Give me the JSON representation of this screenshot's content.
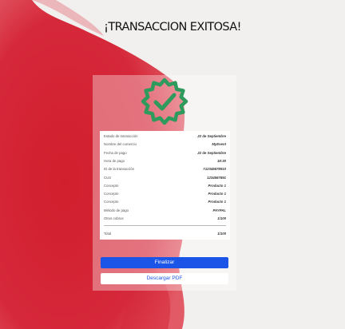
{
  "title": "¡TRANSACCION EXITOSA!",
  "colors": {
    "accent": "#1a55e8",
    "success": "#2e9a5b",
    "background_red": "#d32230"
  },
  "icons": {
    "success_badge": "check-badge-icon"
  },
  "receipt": {
    "rows": [
      {
        "label": "Estado de transacción",
        "value": "22 de Septiembre"
      },
      {
        "label": "Nombre del comercio",
        "value": "MyEvent"
      },
      {
        "label": "Fecha de pago",
        "value": "22 de Septiembre"
      },
      {
        "label": "Hora de pago",
        "value": "18:30"
      },
      {
        "label": "ID de la transacción",
        "value": "#12345678910"
      },
      {
        "label": "CUS",
        "value": "1234567891"
      },
      {
        "label": "Concepto",
        "value": "Producto 1"
      },
      {
        "label": "Concepto",
        "value": "Producto 1"
      },
      {
        "label": "Concepto",
        "value": "Producto 1"
      },
      {
        "label": "Método de pago",
        "value": "PAYPAL"
      },
      {
        "label": "Otros cobros",
        "value": "1/100"
      }
    ],
    "total_label": "Total",
    "total_value": "1/100"
  },
  "buttons": {
    "finish_label": "Finalizar",
    "download_label": "Descargar PDF"
  }
}
